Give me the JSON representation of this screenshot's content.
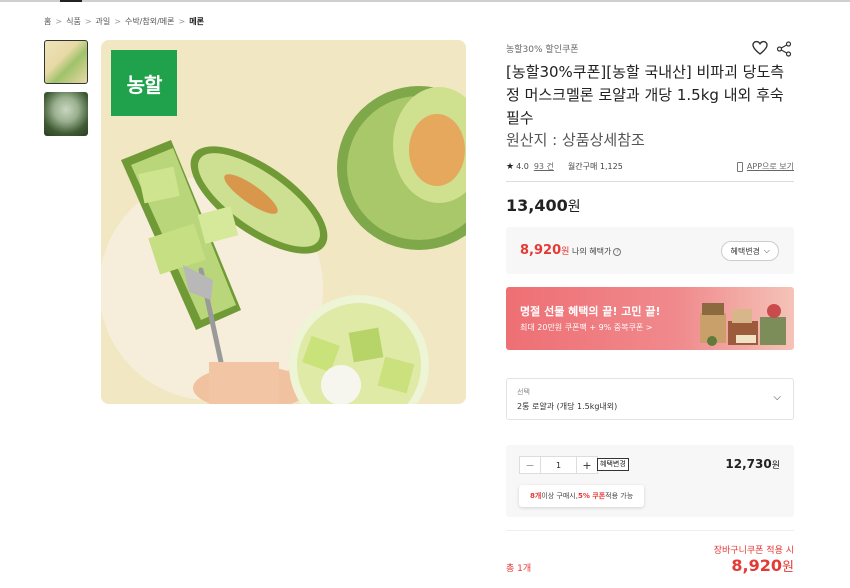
{
  "breadcrumb": [
    "홈",
    "식품",
    "과일",
    "수박/참외/메론",
    "메론"
  ],
  "breadcrumb_sep": ">",
  "thumbnails": [
    {
      "alt": "cut-melon-on-plate"
    },
    {
      "alt": "whole-melon"
    }
  ],
  "main_image": {
    "logo_text": "농할",
    "logo_color": "#20a24c"
  },
  "product": {
    "brand": "농할30% 할인쿠폰",
    "title": "[농할30%쿠폰][농할 국내산] 비파괴 당도측정 머스크멜론 로얄과 개당 1.5kg 내외 후숙필수",
    "origin": "원산지 : 상품상세참조",
    "rating_star": "★",
    "rating": "4.0",
    "reviews": "93 건",
    "monthly": "월간구매 1,125",
    "app_link": "APP으로 보기",
    "price": "13,400",
    "price_unit": "원"
  },
  "benefit": {
    "price": "8,920",
    "unit": "원",
    "label": "나의 혜택가",
    "info": "?",
    "button": "혜택변경",
    "chevron": "⌵"
  },
  "banner": {
    "title": "명절 선물 혜택의 끝! 고민 끝!",
    "subtitle": "최대 20만원 쿠폰팩 + 9% 중복쿠폰 >",
    "colors": {
      "start": "#ee6f74",
      "end": "#f5c3b8"
    }
  },
  "option": {
    "label": "선택",
    "value": "2통 로얄과 (개당 1.5kg내외)",
    "chevron": "⌵"
  },
  "quantity": {
    "minus": "−",
    "value": "1",
    "plus": "+",
    "tag": "혜택변경",
    "line_price": "12,730",
    "unit": "원",
    "tooltip_count": "8개",
    "tooltip_mid": " 이상 구매시, ",
    "tooltip_rate": "5% 쿠폰",
    "tooltip_end": " 적용 가능"
  },
  "total": {
    "cart_coupon": "장바구니쿠폰 적용 시",
    "label": "총 1개",
    "price": "8,920",
    "unit": "원"
  },
  "colors": {
    "accent_red": "#e53935",
    "brand_green": "#20a24c"
  }
}
